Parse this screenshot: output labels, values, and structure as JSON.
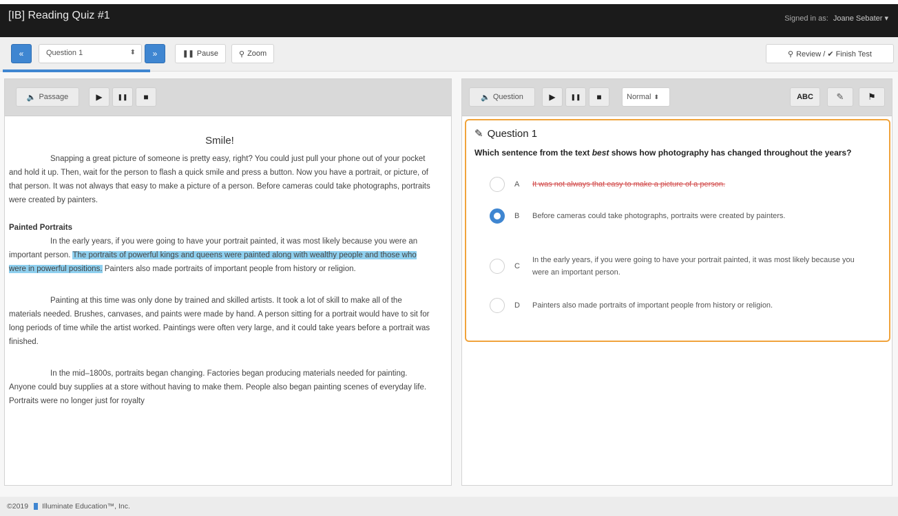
{
  "header": {
    "title": "[IB] Reading Quiz #1",
    "signed_in_label": "Signed in as:",
    "user_name": "Joane Sebater ▾"
  },
  "toolbar": {
    "prev_icon": "«",
    "next_icon": "»",
    "question_select_value": "Question 1",
    "pause_label": "Pause",
    "zoom_label": "Zoom",
    "review_label": "Review / ✔ Finish Test",
    "progress_fraction": 0.33
  },
  "passage_panel": {
    "audio_label": "Passage",
    "play_icon": "▶",
    "pause_icon": "❚❚",
    "stop_icon": "■"
  },
  "question_panel": {
    "audio_label": "Question",
    "speed_value": "Normal",
    "abc_label": "ABC",
    "edit_icon": "pencil-square-icon",
    "flag_icon": "flag-icon"
  },
  "passage": {
    "title": "Smile!",
    "p1": "Snapping a great picture of someone is pretty easy, right? You could just pull your phone out of your pocket and hold it up. Then, wait for the person to flash a quick smile and press a button. Now you have a portrait, or picture, of that person. It was not always that easy to make a picture of a person. Before cameras could take photographs, portraits were created by painters.",
    "sub1": "Painted Portraits",
    "p2_before": "In the early years, if you were going to have your portrait painted, it was most likely because you were an important person. ",
    "p2_highlight": "The portraits of powerful kings and queens were painted along with wealthy people and those who were in powerful positions.",
    "p2_after": " Painters also made portraits of important people from history or religion.",
    "p3": "Painting at this time was only done by trained and skilled artists. It took a lot of skill to make all of the materials needed. Brushes, canvases, and paints were made by hand. A person sitting for a portrait would have to sit for long periods of time while the artist worked. Paintings were often very large, and it could take years before a portrait was finished.",
    "p4": "In the mid–1800s, portraits began changing. Factories began producing materials needed for painting. Anyone could buy supplies at a store without having to make them. People also began painting scenes of everyday life. Portraits were no longer just for royalty"
  },
  "question": {
    "title": "Question 1",
    "stem_before": "Which sentence from the text ",
    "stem_em": "best",
    "stem_after": " shows how photography has changed throughout the years?",
    "choices": [
      {
        "letter": "A",
        "text": "It was not always that easy to make a picture of a person."
      },
      {
        "letter": "B",
        "text": "Before cameras could take photographs, portraits were created by painters."
      },
      {
        "letter": "C",
        "text": "In the early years, if you were going to have your portrait painted, it was most likely because you were an important person."
      },
      {
        "letter": "D",
        "text": "Painters also made portraits of important people from history or religion."
      }
    ],
    "selected": "B",
    "struck": "A"
  },
  "footer": {
    "copyright": "©2019",
    "company": "Illuminate Education™, Inc."
  },
  "colors": {
    "accent": "#3f86d1",
    "focus_border": "#f0a33b",
    "highlight": "#8fd0ef",
    "struck": "#d24b4b"
  }
}
